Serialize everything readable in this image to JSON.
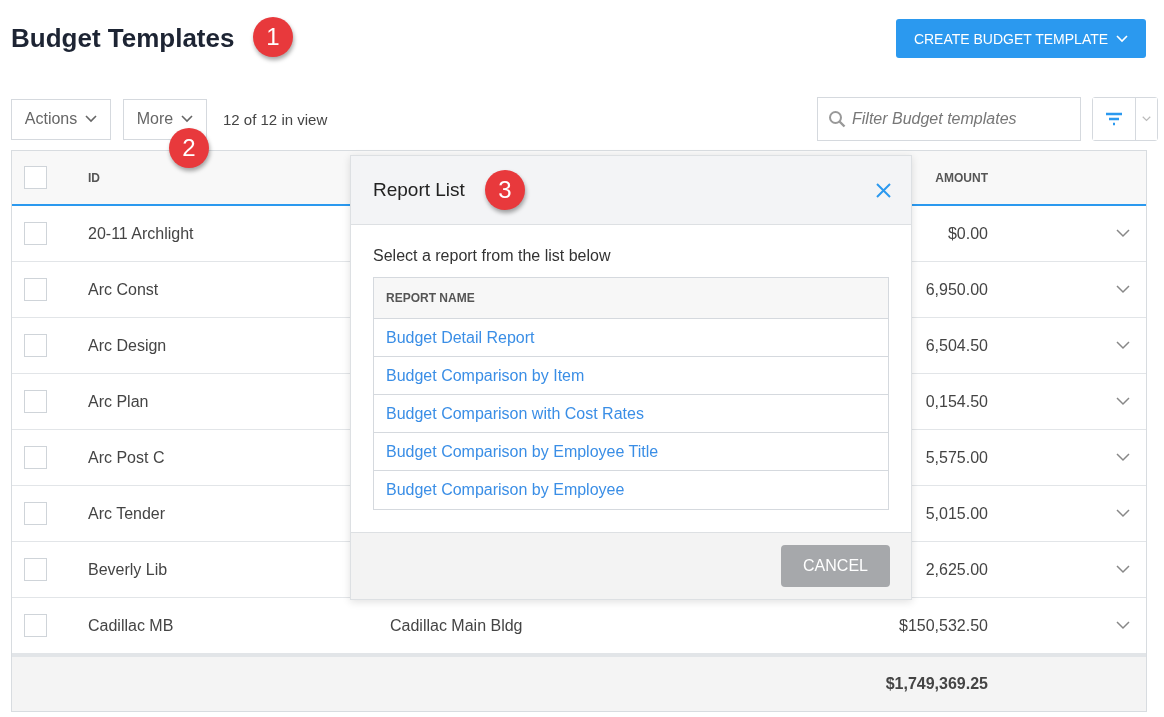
{
  "page": {
    "title": "Budget Templates",
    "create_button": "CREATE BUDGET TEMPLATE"
  },
  "toolbar": {
    "actions": "Actions",
    "more": "More",
    "count": "12 of 12 in view",
    "search": {
      "placeholder": "Filter Budget templates"
    }
  },
  "table": {
    "header_checked": false,
    "columns": [
      {
        "label": "ID"
      },
      {
        "label": "AMOUNT"
      }
    ],
    "rows": [
      {
        "id": "20-11 Archlight",
        "amount": "$0.00",
        "checked": false
      },
      {
        "id": "Arc Const",
        "amount": "6,950.00",
        "checked": false
      },
      {
        "id": "Arc Design",
        "amount": "6,504.50",
        "checked": false
      },
      {
        "id": "Arc Plan",
        "amount": "0,154.50",
        "checked": false
      },
      {
        "id": "Arc Post C",
        "amount": "5,575.00",
        "checked": false
      },
      {
        "id": "Arc Tender",
        "amount": "5,015.00",
        "checked": false
      },
      {
        "id": "Beverly Lib",
        "amount": "2,625.00",
        "checked": false
      },
      {
        "id": "Cadillac MB",
        "description": "Cadillac Main Bldg",
        "amount": "$150,532.50",
        "checked": false
      }
    ],
    "total": "$1,749,369.25"
  },
  "dialog": {
    "title": "Report List",
    "instruction": "Select a report from the list below",
    "column": "REPORT NAME",
    "reports": [
      "Budget Detail Report",
      "Budget Comparison by Item",
      "Budget Comparison with Cost Rates",
      "Budget Comparison by Employee Title",
      "Budget Comparison by Employee"
    ],
    "cancel": "CANCEL"
  },
  "callouts": [
    "1",
    "2",
    "3"
  ]
}
